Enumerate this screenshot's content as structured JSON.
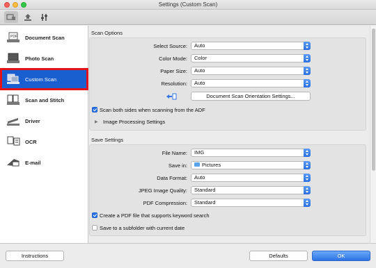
{
  "window": {
    "title": "Settings (Custom Scan)"
  },
  "sidebar": {
    "items": [
      {
        "label": "Document Scan",
        "icon": "document-scan-icon"
      },
      {
        "label": "Photo Scan",
        "icon": "photo-scan-icon"
      },
      {
        "label": "Custom Scan",
        "icon": "custom-scan-icon",
        "selected": true
      },
      {
        "label": "Scan and Stitch",
        "icon": "scan-stitch-icon"
      },
      {
        "label": "Driver",
        "icon": "driver-icon"
      },
      {
        "label": "OCR",
        "icon": "ocr-icon"
      },
      {
        "label": "E-mail",
        "icon": "email-icon"
      }
    ]
  },
  "scan_options": {
    "title": "Scan Options",
    "select_source": {
      "label": "Select Source:",
      "value": "Auto"
    },
    "color_mode": {
      "label": "Color Mode:",
      "value": "Color"
    },
    "paper_size": {
      "label": "Paper Size:",
      "value": "Auto"
    },
    "resolution": {
      "label": "Resolution:",
      "value": "Auto"
    },
    "orientation_button": "Document Scan Orientation Settings...",
    "both_sides": {
      "label": "Scan both sides when scanning from the ADF",
      "checked": true
    },
    "image_processing": "Image Processing Settings"
  },
  "save_settings": {
    "title": "Save Settings",
    "file_name": {
      "label": "File Name:",
      "value": "IMG"
    },
    "save_in": {
      "label": "Save in:",
      "value": "Pictures"
    },
    "data_format": {
      "label": "Data Format:",
      "value": "Auto"
    },
    "jpeg_quality": {
      "label": "JPEG Image Quality:",
      "value": "Standard"
    },
    "pdf_compression": {
      "label": "PDF Compression:",
      "value": "Standard"
    },
    "keyword_pdf": {
      "label": "Create a PDF file that supports keyword search",
      "checked": true
    },
    "subfolder": {
      "label": "Save to a subfolder with current date",
      "checked": false
    }
  },
  "footer": {
    "instructions": "Instructions",
    "defaults": "Defaults",
    "ok": "OK"
  },
  "colors": {
    "selected": "#1a5fd0",
    "highlight_border": "#e2141a",
    "accent": "#2f73e4"
  }
}
